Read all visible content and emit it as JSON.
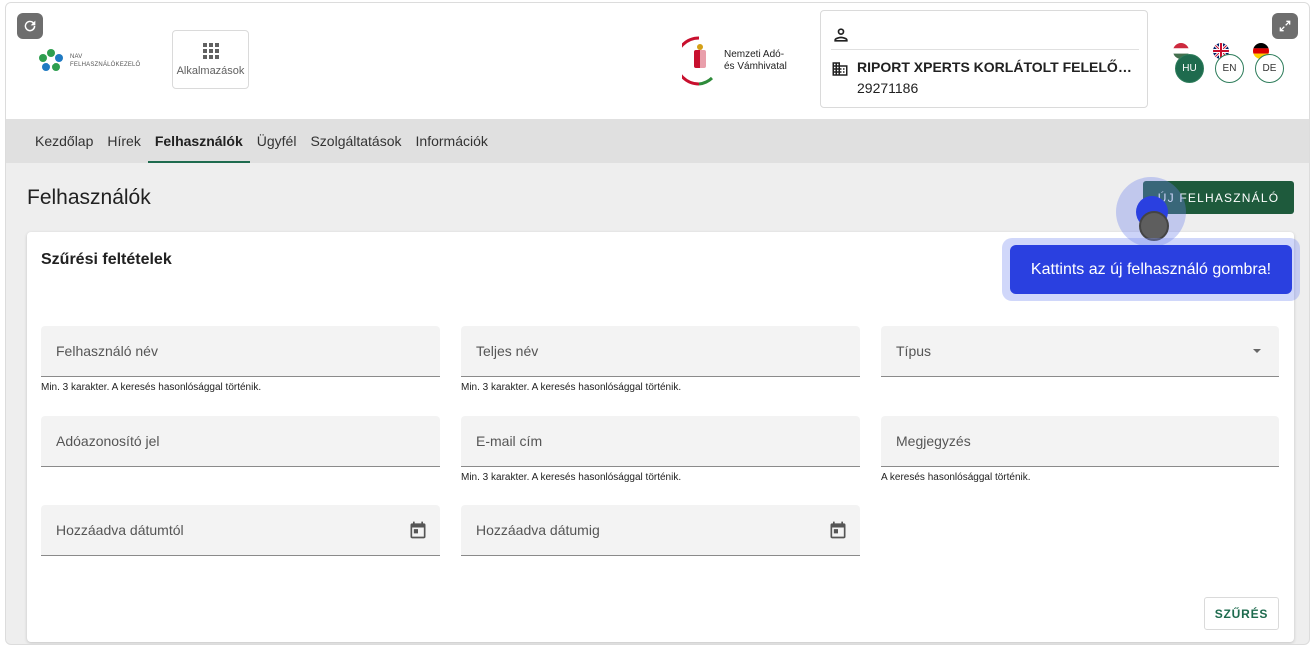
{
  "header": {
    "brand_line1": "NAV",
    "brand_line2": "FELHASZNÁLÓKEZELŐ",
    "apps_label": "Alkalmazások",
    "authority_line1": "Nemzeti Adó-",
    "authority_line2": "és Vámhivatal",
    "account": {
      "company_name": "RIPORT XPERTS KORLÁTOLT FELELŐSSÉ…",
      "company_id": "29271186"
    },
    "languages": [
      {
        "code": "HU",
        "active": true
      },
      {
        "code": "EN",
        "active": false
      },
      {
        "code": "DE",
        "active": false
      }
    ]
  },
  "nav": {
    "tabs": [
      {
        "label": "Kezdőlap"
      },
      {
        "label": "Hírek"
      },
      {
        "label": "Felhasználók"
      },
      {
        "label": "Ügyfél"
      },
      {
        "label": "Szolgáltatások"
      },
      {
        "label": "Információk"
      }
    ],
    "active": "Felhasználók"
  },
  "page": {
    "title": "Felhasználók",
    "new_user_button": "ÚJ FELHASZNÁLÓ"
  },
  "filters": {
    "title": "Szűrési feltételek",
    "fields": {
      "username": {
        "label": "Felhasználó név",
        "hint": "Min. 3 karakter. A keresés hasonlósággal történik."
      },
      "fullname": {
        "label": "Teljes név",
        "hint": "Min. 3 karakter. A keresés hasonlósággal történik."
      },
      "type": {
        "label": "Típus"
      },
      "taxid": {
        "label": "Adóazonosító jel"
      },
      "email": {
        "label": "E-mail cím",
        "hint": "Min. 3 karakter. A keresés hasonlósággal történik."
      },
      "note": {
        "label": "Megjegyzés",
        "hint": "A keresés hasonlósággal történik."
      },
      "date_from": {
        "label": "Hozzáadva dátumtól"
      },
      "date_to": {
        "label": "Hozzáadva dátumig"
      }
    },
    "filter_button": "SZŰRÉS"
  },
  "tutorial": {
    "tooltip": "Kattints az új felhasználó gombra!"
  },
  "colors": {
    "accent": "#1e6b4e",
    "primary_button": "#1e5a3c",
    "tooltip": "#2a40e0"
  }
}
